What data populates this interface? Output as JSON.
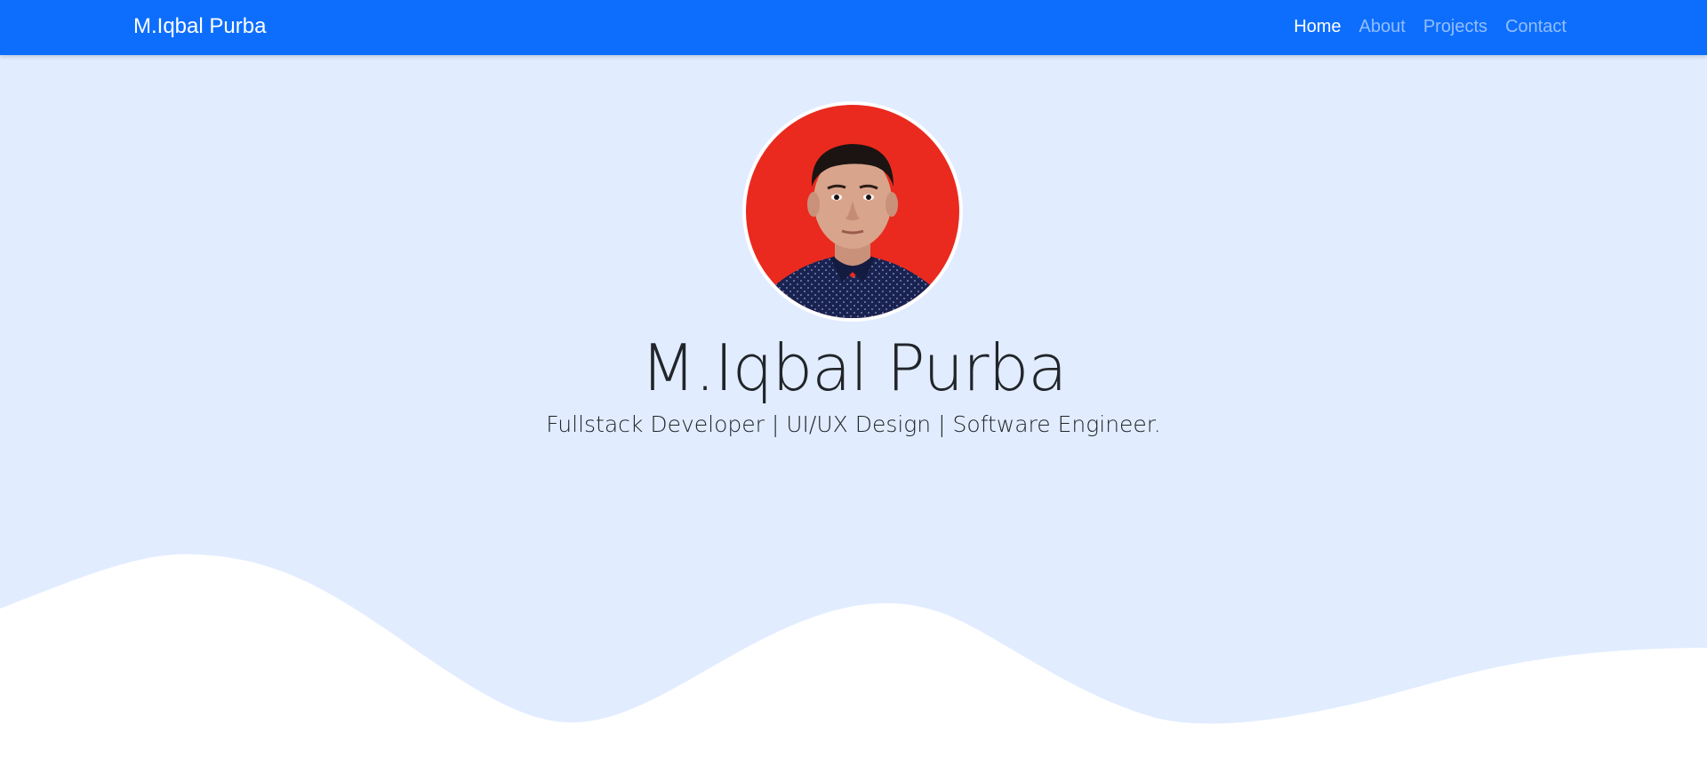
{
  "navbar": {
    "brand": "M.Iqbal Purba",
    "links": [
      {
        "label": "Home",
        "active": true
      },
      {
        "label": "About",
        "active": false
      },
      {
        "label": "Projects",
        "active": false
      },
      {
        "label": "Contact",
        "active": false
      }
    ]
  },
  "hero": {
    "title": "M.Iqbal Purba",
    "subtitle": "Fullstack Developer | UI/UX Design | Software Engineer.",
    "profile_image": "profile-photo"
  },
  "colors": {
    "navbar_bg": "#0d6efd",
    "hero_bg": "#e1ecff",
    "wave": "#ffffff",
    "text": "#212529"
  }
}
